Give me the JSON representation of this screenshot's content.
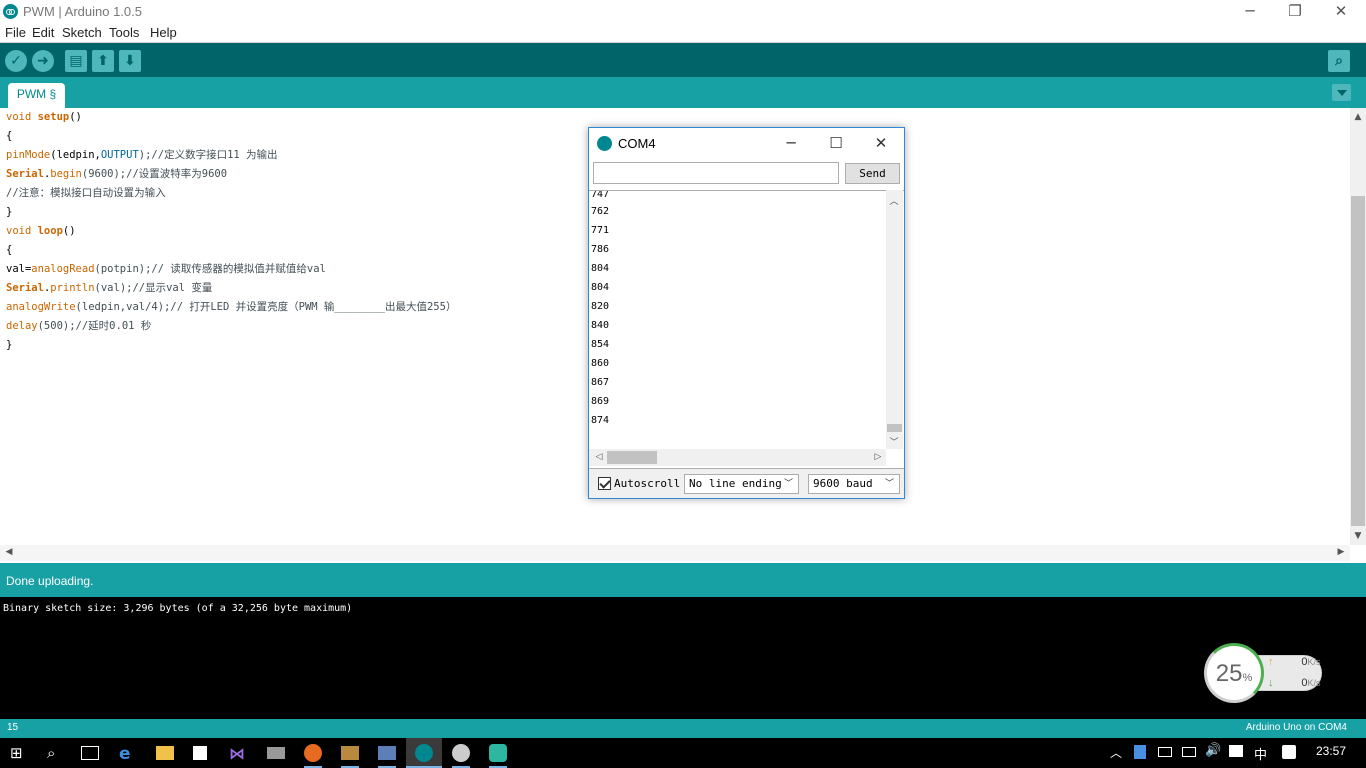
{
  "window": {
    "title": "PWM | Arduino 1.0.5",
    "minimize": "─",
    "maximize": "❐",
    "close": "✕"
  },
  "menu": [
    "File",
    "Edit",
    "Sketch",
    "Tools",
    "Help"
  ],
  "toolbar": {
    "verify_icon": "checkmark-icon",
    "upload_icon": "arrow-right-icon",
    "new_icon": "new-file-icon",
    "open_icon": "open-arrow-up-icon",
    "save_icon": "save-arrow-down-icon",
    "serial_icon": "magnifier-icon"
  },
  "tabs": [
    {
      "label": "PWM §"
    }
  ],
  "editor": {
    "lines": [
      [
        "void ",
        "setup",
        "()"
      ],
      [
        "{"
      ],
      [
        "pinMode",
        "(ledpin,",
        "OUTPUT",
        ");//定义数字接口11 为输出"
      ],
      [
        "Serial",
        ".",
        "begin",
        "(9600);//设置波特率为9600"
      ],
      [
        "//注意：模拟接口自动设置为输入"
      ],
      [
        "}"
      ],
      [
        "void ",
        "loop",
        "()"
      ],
      [
        "{"
      ],
      [
        "val=",
        "analogRead",
        "(potpin);// 读取传感器的模拟值并赋值给val"
      ],
      [
        "Serial",
        ".",
        "println",
        "(val);//显示val 变量"
      ],
      [
        "analogWrite",
        "(ledpin,val/4);// 打开LED 并设置亮度（PWM 输________出最大值255）"
      ],
      [
        "delay",
        "(500);//延时0.01 秒"
      ],
      [
        "}"
      ]
    ]
  },
  "status": {
    "message": "Done uploading."
  },
  "console": {
    "text": "Binary sketch size: 3,296 bytes (of a 32,256 byte maximum)"
  },
  "footer": {
    "line": "15",
    "board": "Arduino Uno on COM4"
  },
  "serial_monitor": {
    "title": "COM4",
    "input_value": "",
    "send_label": "Send",
    "output": [
      "747",
      "762",
      "771",
      "786",
      "804",
      "804",
      "820",
      "840",
      "854",
      "860",
      "867",
      "869",
      "874"
    ],
    "autoscroll_label": "Autoscroll",
    "autoscroll_checked": true,
    "line_ending": "No line ending",
    "baud": "9600 baud"
  },
  "speed_widget": {
    "percent": "25",
    "percent_unit": "%",
    "upload": "0",
    "download": "0",
    "unit": "K/s"
  },
  "taskbar": {
    "icons": [
      "windows-start-icon",
      "search-icon",
      "task-view-icon",
      "edge-icon",
      "file-explorer-icon",
      "store-icon",
      "visual-studio-icon",
      "app-icon",
      "firefox-icon",
      "app-icon-2",
      "app-icon-3",
      "arduino-icon",
      "app-icon-4",
      "app-icon-5"
    ],
    "ime": "中",
    "time": "23:57"
  },
  "colors": {
    "teal_dark": "#006468",
    "teal": "#17a1a5",
    "keyword": "#cc6600"
  }
}
